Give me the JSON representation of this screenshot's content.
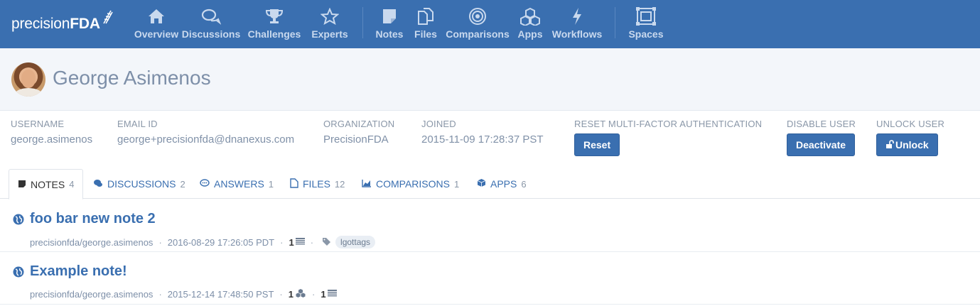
{
  "brand": {
    "light": "precision",
    "bold": "FDA"
  },
  "nav": {
    "group1": [
      {
        "label": "Overview",
        "icon": "home-icon"
      },
      {
        "label": "Discussions",
        "icon": "chat-bubbles-icon"
      },
      {
        "label": "Challenges",
        "icon": "trophy-icon"
      },
      {
        "label": "Experts",
        "icon": "star-icon"
      }
    ],
    "group2": [
      {
        "label": "Notes",
        "icon": "note-icon"
      },
      {
        "label": "Files",
        "icon": "files-icon"
      },
      {
        "label": "Comparisons",
        "icon": "target-icon"
      },
      {
        "label": "Apps",
        "icon": "cubes-icon"
      },
      {
        "label": "Workflows",
        "icon": "bolt-icon"
      }
    ],
    "group3": [
      {
        "label": "Spaces",
        "icon": "spaces-icon"
      }
    ]
  },
  "profile": {
    "name": "George Asimenos"
  },
  "info": {
    "username": {
      "key": "USERNAME",
      "value": "george.asimenos"
    },
    "email": {
      "key": "EMAIL ID",
      "value": "george+precisionfda@dnanexus.com"
    },
    "organization": {
      "key": "ORGANIZATION",
      "value": "PrecisionFDA"
    },
    "joined": {
      "key": "JOINED",
      "value": "2015-11-09 17:28:37 PST"
    },
    "mfa": {
      "key": "RESET MULTI-FACTOR AUTHENTICATION",
      "button": "Reset"
    },
    "disable": {
      "key": "DISABLE USER",
      "button": "Deactivate"
    },
    "unlock": {
      "key": "UNLOCK USER",
      "button": "Unlock"
    }
  },
  "tabs": [
    {
      "label": "NOTES",
      "count": "4",
      "icon": "note-icon",
      "active": true
    },
    {
      "label": "DISCUSSIONS",
      "count": "2",
      "icon": "chat-bubbles-icon"
    },
    {
      "label": "ANSWERS",
      "count": "1",
      "icon": "comment-icon"
    },
    {
      "label": "FILES",
      "count": "12",
      "icon": "file-icon"
    },
    {
      "label": "COMPARISONS",
      "count": "1",
      "icon": "area-chart-icon"
    },
    {
      "label": "APPS",
      "count": "6",
      "icon": "cube-icon"
    }
  ],
  "notes": [
    {
      "title": "foo bar new note 2",
      "author": "precisionfda/george.asimenos",
      "date": "2016-08-29 17:26:05 PDT",
      "attachments": [
        {
          "count": "1",
          "icon": "list-icon"
        }
      ],
      "tag": "lgottags"
    },
    {
      "title": "Example note!",
      "author": "precisionfda/george.asimenos",
      "date": "2015-12-14 17:48:50 PST",
      "attachments": [
        {
          "count": "1",
          "icon": "cubes-icon"
        },
        {
          "count": "1",
          "icon": "list-icon"
        }
      ]
    }
  ],
  "colors": {
    "navbar": "#3a6fb0",
    "accent": "#3a6fb0",
    "muted": "#8a97a8"
  }
}
